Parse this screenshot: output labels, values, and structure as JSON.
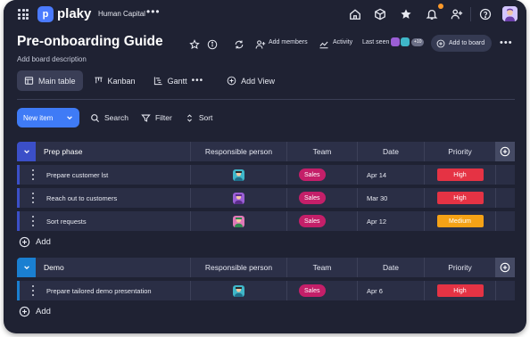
{
  "app": {
    "logo_letter": "p",
    "name": "plaky",
    "workspace": "Human Capital",
    "workspace_more": "•••"
  },
  "topbar_icons": [
    "home-icon",
    "cube-icon",
    "star-icon",
    "bell-icon",
    "add-user-icon",
    "help-icon",
    "user-avatar"
  ],
  "board": {
    "title": "Pre-onboarding Guide",
    "description": "Add board description",
    "actions": {
      "add_members": "Add members",
      "activity": "Activity",
      "last_seen": "Last seen",
      "last_seen_count": "+10",
      "add_to_board": "Add to board",
      "more": "•••"
    }
  },
  "tabs": [
    {
      "label": "Main table",
      "icon": "table-icon",
      "active": true
    },
    {
      "label": "Kanban",
      "icon": "kanban-icon",
      "active": false
    },
    {
      "label": "Gantt",
      "icon": "gantt-icon",
      "active": false
    }
  ],
  "tabs_more": "•••",
  "add_view": "Add View",
  "toolbar": {
    "new_item": "New item",
    "search": "Search",
    "filter": "Filter",
    "sort": "Sort"
  },
  "columns": {
    "person": "Responsible person",
    "team": "Team",
    "date": "Date",
    "priority": "Priority"
  },
  "colors": {
    "accent": "#3f7bf6",
    "prep_group": "#3b4fc8",
    "demo_group": "#1a7fd1",
    "sales": "#c41f69",
    "high": "#e53344",
    "medium": "#f5a216"
  },
  "groups": [
    {
      "name": "Prep phase",
      "color": "#3b4fc8",
      "rows": [
        {
          "name": "Prepare customer lst",
          "team": "Sales",
          "date": "Apr 14",
          "priority": "High",
          "priority_color": "#e53344",
          "avatar": "#3fb7c9"
        },
        {
          "name": "Reach out to customers",
          "team": "Sales",
          "date": "Mar 30",
          "priority": "High",
          "priority_color": "#e53344",
          "avatar": "#9b5fd6"
        },
        {
          "name": "Sort requests",
          "team": "Sales",
          "date": "Apr 12",
          "priority": "Medium",
          "priority_color": "#f5a216",
          "avatar": "#e07ab8"
        }
      ],
      "add_label": "Add"
    },
    {
      "name": "Demo",
      "color": "#1a7fd1",
      "rows": [
        {
          "name": "Prepare tailored demo presentation",
          "team": "Sales",
          "date": "Apr 6",
          "priority": "High",
          "priority_color": "#e53344",
          "avatar": "#3fb7c9"
        }
      ],
      "add_label": "Add"
    }
  ]
}
